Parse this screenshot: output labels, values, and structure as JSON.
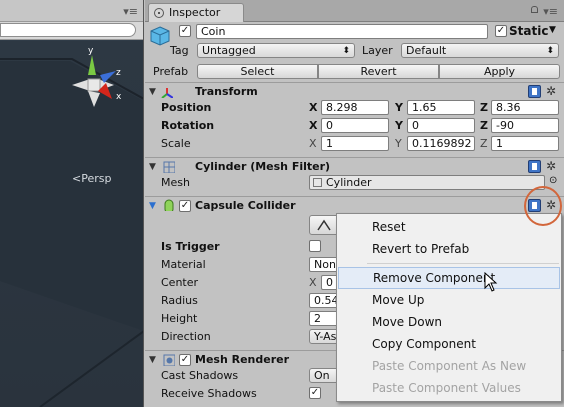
{
  "inspector": {
    "tab_label": "Inspector",
    "object": {
      "name": "Coin",
      "active": true,
      "static_label": "Static",
      "static_checked": true,
      "tag_label": "Tag",
      "tag_value": "Untagged",
      "layer_label": "Layer",
      "layer_value": "Default",
      "prefab_label": "Prefab",
      "prefab_buttons": [
        "Select",
        "Revert",
        "Apply"
      ]
    },
    "transform": {
      "title": "Transform",
      "position_label": "Position",
      "position": {
        "x": "8.298",
        "y": "1.65",
        "z": "8.36"
      },
      "rotation_label": "Rotation",
      "rotation": {
        "x": "0",
        "y": "0",
        "z": "-90"
      },
      "scale_label": "Scale",
      "scale": {
        "x": "1",
        "y": "0.1169892",
        "z": "1"
      },
      "axis_labels": {
        "x": "X",
        "y": "Y",
        "z": "Z"
      }
    },
    "mesh_filter": {
      "title": "Cylinder (Mesh Filter)",
      "mesh_label": "Mesh",
      "mesh_value": "Cylinder"
    },
    "capsule_collider": {
      "title": "Capsule Collider",
      "enabled": true,
      "is_trigger_label": "Is Trigger",
      "material_label": "Material",
      "material_value": "None",
      "center_label": "Center",
      "center_x": "0",
      "radius_label": "Radius",
      "radius_value": "0.54",
      "height_label": "Height",
      "height_value": "2",
      "direction_label": "Direction",
      "direction_value": "Y-As"
    },
    "mesh_renderer": {
      "title": "Mesh Renderer",
      "enabled": true,
      "cast_shadows_label": "Cast Shadows",
      "cast_shadows_value": "On",
      "receive_shadows_label": "Receive Shadows",
      "receive_shadows": true
    }
  },
  "scene": {
    "projection_label": "<Persp"
  },
  "context_menu": {
    "items": [
      {
        "label": "Reset",
        "enabled": true
      },
      {
        "label": "Revert to Prefab",
        "enabled": true
      },
      {
        "label": "Remove Component",
        "enabled": true,
        "highlighted": true
      },
      {
        "label": "Move Up",
        "enabled": true
      },
      {
        "label": "Move Down",
        "enabled": true
      },
      {
        "label": "Copy Component",
        "enabled": true
      },
      {
        "label": "Paste Component As New",
        "enabled": false
      },
      {
        "label": "Paste Component Values",
        "enabled": false
      }
    ]
  },
  "colors": {
    "highlight_circle": "#d2663b",
    "menu_highlight": "#e4ecf7",
    "scene_background": "#2f3b47"
  }
}
